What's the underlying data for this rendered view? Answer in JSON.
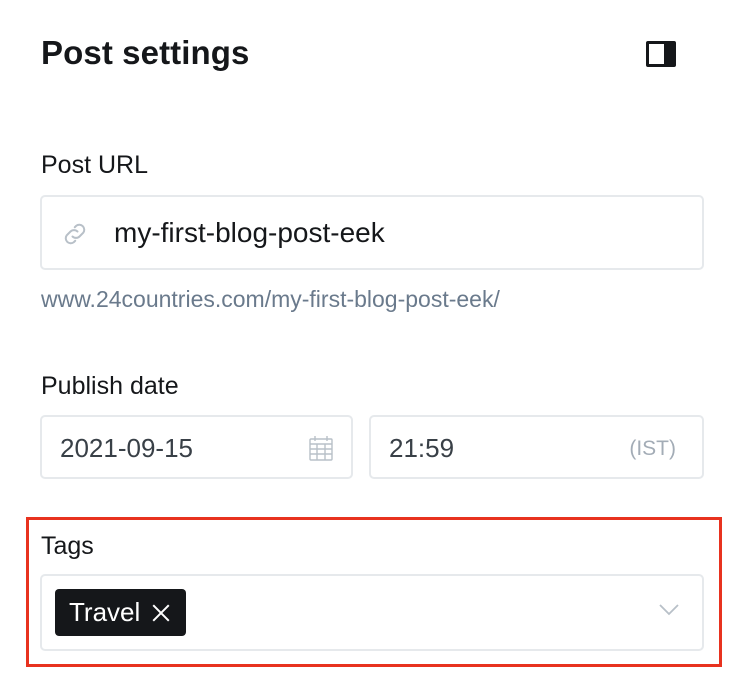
{
  "header": {
    "title": "Post settings",
    "toggle_icon": "sidebar-toggle-icon"
  },
  "post_url": {
    "label": "Post URL",
    "value": "my-first-blog-post-eek",
    "icon": "link-icon",
    "preview": "www.24countries.com/my-first-blog-post-eek/"
  },
  "publish_date": {
    "label": "Publish date",
    "date": "2021-09-15",
    "date_icon": "calendar-icon",
    "time": "21:59",
    "timezone": "(IST)"
  },
  "tags": {
    "label": "Tags",
    "items": [
      {
        "label": "Travel",
        "remove_icon": "close-icon"
      }
    ],
    "dropdown_icon": "chevron-down-icon"
  },
  "colors": {
    "text": "#15171a",
    "muted": "#6a7a8c",
    "border": "#e6e9ec",
    "highlight": "#e8321f",
    "chip_bg": "#15171a"
  }
}
